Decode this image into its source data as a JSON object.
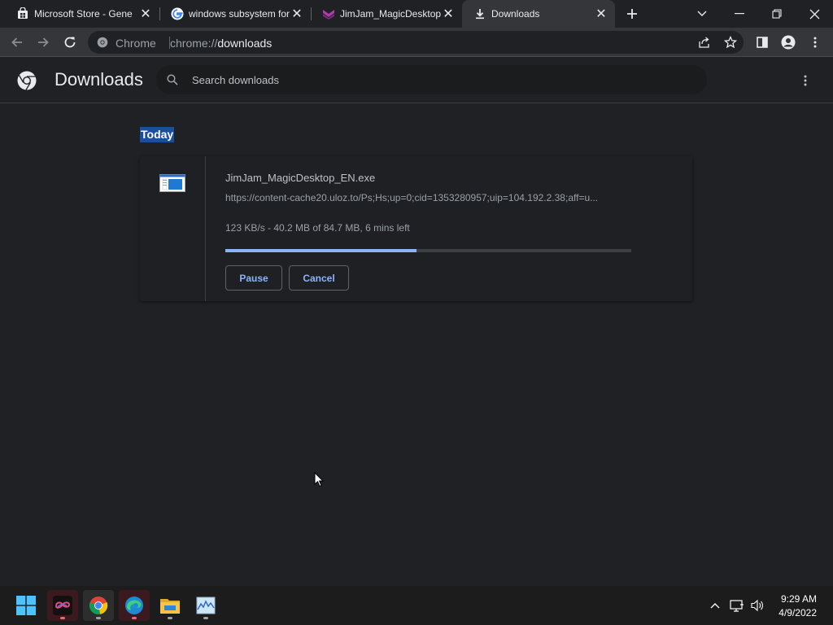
{
  "tabs": [
    {
      "title": "Microsoft Store - Gene",
      "icon": "store-icon"
    },
    {
      "title": "windows subsystem for",
      "icon": "google-icon"
    },
    {
      "title": "JimJam_MagicDesktop",
      "icon": "jimjam-icon"
    },
    {
      "title": "Downloads",
      "icon": "download-icon",
      "active": true
    }
  ],
  "omnibox": {
    "site": "Chrome",
    "url_prefix": "chrome://",
    "url_host": "downloads"
  },
  "page": {
    "title": "Downloads",
    "search_placeholder": "Search downloads"
  },
  "section": {
    "date": "Today"
  },
  "download": {
    "file_name": "JimJam_MagicDesktop_EN.exe",
    "url": "https://content-cache20.uloz.to/Ps;Hs;up=0;cid=1353280957;uip=104.192.2.38;aff=u...",
    "status": "123 KB/s - 40.2 MB of 84.7 MB, 6 mins left",
    "progress": 0.47,
    "pause_label": "Pause",
    "cancel_label": "Cancel"
  },
  "taskbar": {
    "time": "9:29 AM",
    "date": "4/9/2022"
  },
  "colors": {
    "accent": "#8ab4f8",
    "highlight": "#1a4f9c"
  }
}
